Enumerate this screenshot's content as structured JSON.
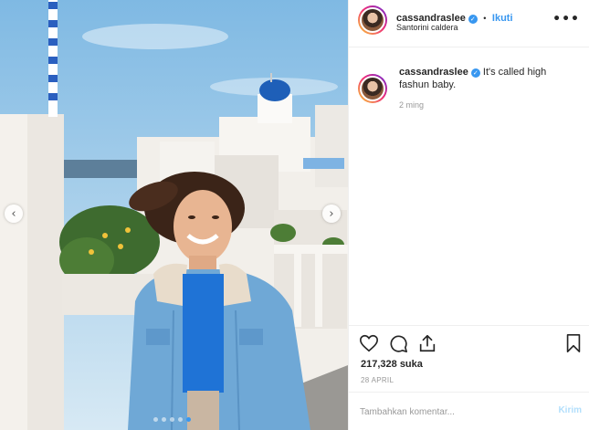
{
  "post": {
    "username": "cassandraslee",
    "follow_label": "Ikuti",
    "separator": "•",
    "location": "Santorini caldera",
    "more_label": "•••",
    "caption": "It's called high fashun baby.",
    "time_ago": "2 ming",
    "likes": "217,328 suka",
    "date": "28 APRIL",
    "comment_placeholder": "Tambahkan komentar...",
    "post_label": "Kirim"
  },
  "carousel": {
    "prev_icon": "‹",
    "next_icon": "›",
    "slide_count": 5,
    "active_index": 4
  },
  "colors": {
    "link_blue": "#3897f0",
    "post_disabled": "#b2dffc",
    "sky": "#8ec5e8",
    "jacket": "#6fa8d6"
  },
  "icons": {
    "verified": "verified-badge-icon",
    "like": "heart-icon",
    "comment": "comment-bubble-icon",
    "share": "share-icon",
    "save": "bookmark-icon"
  }
}
